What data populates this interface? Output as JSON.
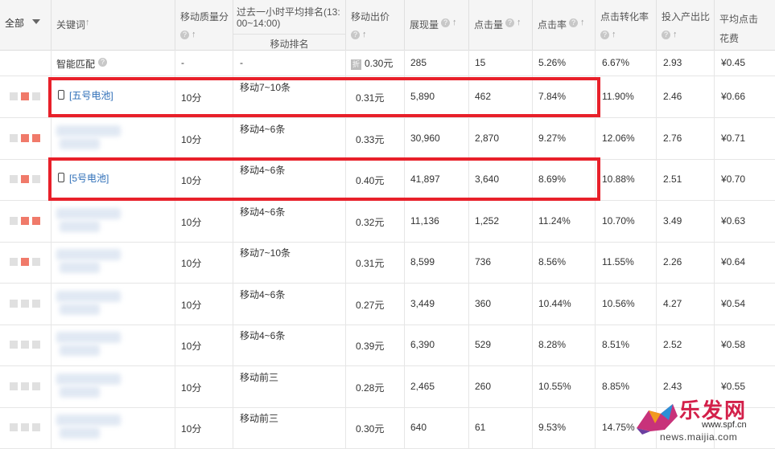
{
  "header": {
    "filter": "全部",
    "keyword": "关键词",
    "quality": "移动质量分",
    "rank_title": "过去一小时平均排名(13:00~14:00)",
    "rank_sub": "移动排名",
    "bid": "移动出价",
    "impressions": "展现量",
    "clicks": "点击量",
    "ctr": "点击率",
    "cvr": "点击转化率",
    "roi": "投入产出比",
    "cpc": "平均点击花费"
  },
  "smart": {
    "keyword": "智能匹配",
    "quality": "-",
    "rank": "-",
    "bid_badge": "折",
    "bid": "0.30元",
    "impressions": "285",
    "clicks": "15",
    "ctr": "5.26%",
    "cvr": "6.67%",
    "roi": "2.93",
    "cpc": "¥0.45"
  },
  "rows": [
    {
      "keyword": "[五号电池]",
      "quality": "10分",
      "rank": "移动7~10条",
      "bid": "0.31元",
      "impressions": "5,890",
      "clicks": "462",
      "ctr": "7.84%",
      "cvr": "11.90%",
      "roi": "2.46",
      "cpc": "¥0.66"
    },
    {
      "keyword": "",
      "quality": "10分",
      "rank": "移动4~6条",
      "bid": "0.33元",
      "impressions": "30,960",
      "clicks": "2,870",
      "ctr": "9.27%",
      "cvr": "12.06%",
      "roi": "2.76",
      "cpc": "¥0.71"
    },
    {
      "keyword": "[5号电池]",
      "quality": "10分",
      "rank": "移动4~6条",
      "bid": "0.40元",
      "impressions": "41,897",
      "clicks": "3,640",
      "ctr": "8.69%",
      "cvr": "10.88%",
      "roi": "2.51",
      "cpc": "¥0.70"
    },
    {
      "keyword": "",
      "quality": "10分",
      "rank": "移动4~6条",
      "bid": "0.32元",
      "impressions": "11,136",
      "clicks": "1,252",
      "ctr": "11.24%",
      "cvr": "10.70%",
      "roi": "3.49",
      "cpc": "¥0.63"
    },
    {
      "keyword": "",
      "quality": "10分",
      "rank": "移动7~10条",
      "bid": "0.31元",
      "impressions": "8,599",
      "clicks": "736",
      "ctr": "8.56%",
      "cvr": "11.55%",
      "roi": "2.26",
      "cpc": "¥0.64"
    },
    {
      "keyword": "",
      "quality": "10分",
      "rank": "移动4~6条",
      "bid": "0.27元",
      "impressions": "3,449",
      "clicks": "360",
      "ctr": "10.44%",
      "cvr": "10.56%",
      "roi": "4.27",
      "cpc": "¥0.54"
    },
    {
      "keyword": "",
      "quality": "10分",
      "rank": "移动4~6条",
      "bid": "0.39元",
      "impressions": "6,390",
      "clicks": "529",
      "ctr": "8.28%",
      "cvr": "8.51%",
      "roi": "2.52",
      "cpc": "¥0.58"
    },
    {
      "keyword": "",
      "quality": "10分",
      "rank": "移动前三",
      "bid": "0.28元",
      "impressions": "2,465",
      "clicks": "260",
      "ctr": "10.55%",
      "cvr": "8.85%",
      "roi": "2.43",
      "cpc": "¥0.55"
    },
    {
      "keyword": "",
      "quality": "10分",
      "rank": "移动前三",
      "bid": "0.30元",
      "impressions": "640",
      "clicks": "61",
      "ctr": "9.53%",
      "cvr": "14.75%",
      "roi": "",
      "cpc": ""
    }
  ],
  "watermark": {
    "title": "乐发网",
    "url": "news.maijia.com",
    "site": "www.spf.cn"
  },
  "colors": {
    "highlight": "#e8202a",
    "link": "#2f6fb8",
    "tag_red": "#f07a6a"
  }
}
